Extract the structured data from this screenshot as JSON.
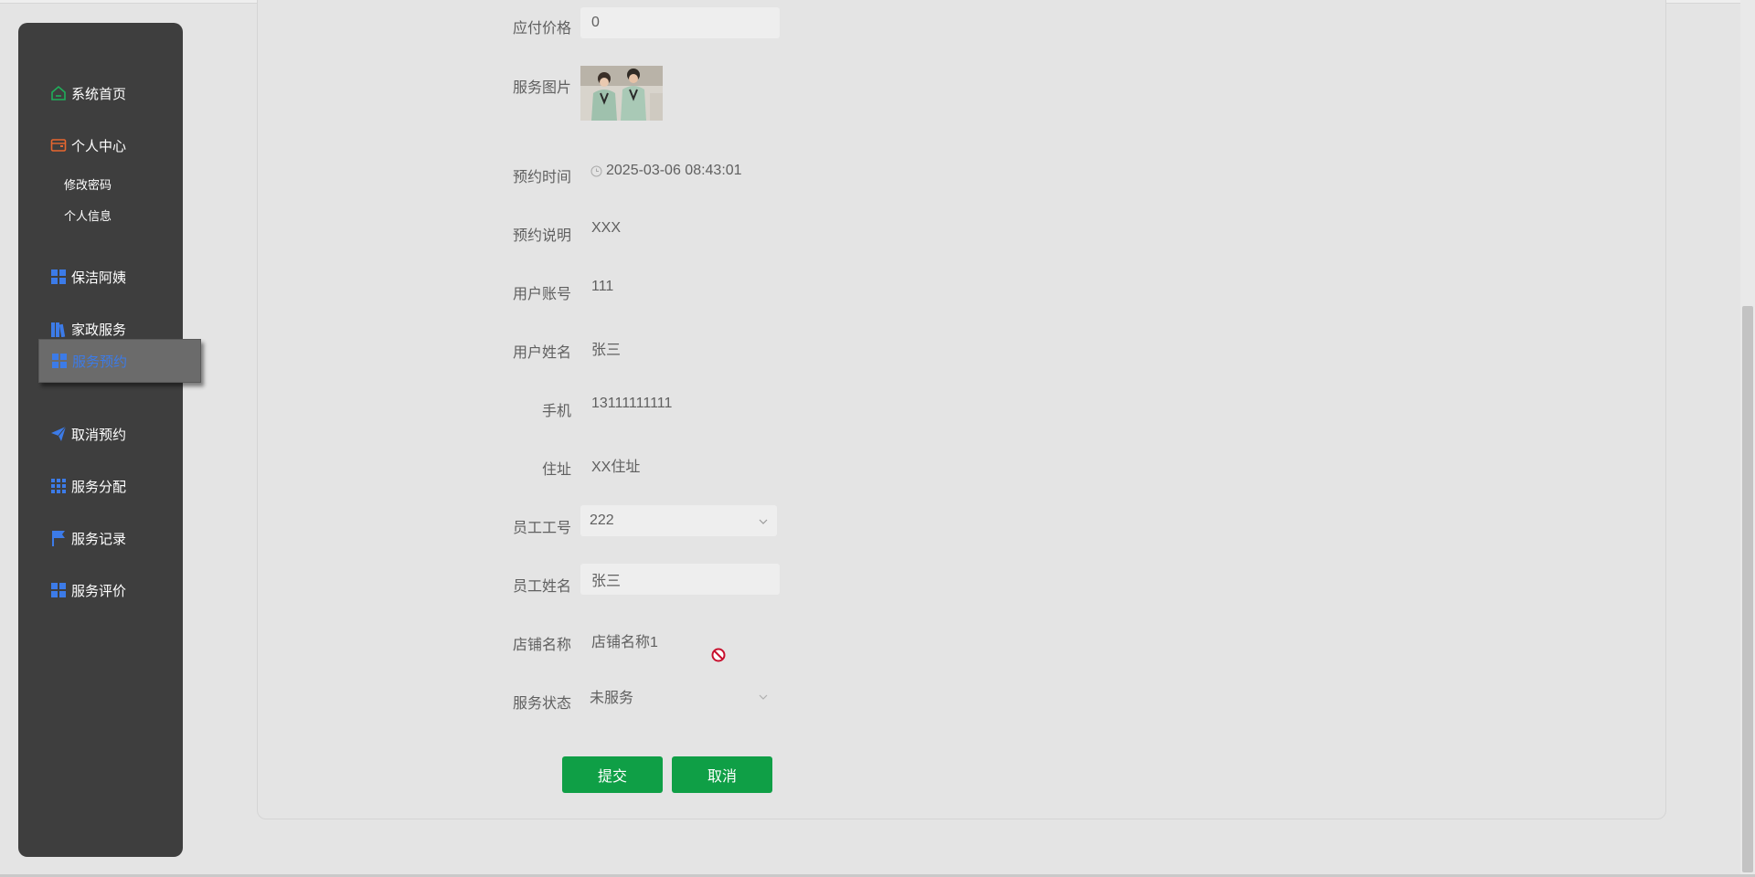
{
  "sidebar": {
    "items": [
      {
        "label": "系统首页",
        "icon": "home-icon"
      },
      {
        "label": "个人中心",
        "icon": "wallet-icon"
      },
      {
        "label": "保洁阿姨",
        "icon": "grid-icon"
      },
      {
        "label": "家政服务",
        "icon": "books-icon"
      },
      {
        "label": "服务预约",
        "icon": "grid-icon"
      },
      {
        "label": "取消预约",
        "icon": "send-icon"
      },
      {
        "label": "服务分配",
        "icon": "apps-icon"
      },
      {
        "label": "服务记录",
        "icon": "flag-icon"
      },
      {
        "label": "服务评价",
        "icon": "grid-icon"
      }
    ],
    "sub_items": [
      "修改密码",
      "个人信息"
    ],
    "active_item": "服务预约"
  },
  "form": {
    "price_label": "应付价格",
    "price_value": "0",
    "image_label": "服务图片",
    "time_label": "预约时间",
    "time_value": "2025-03-06 08:43:01",
    "desc_label": "预约说明",
    "desc_value": "XXX",
    "account_label": "用户账号",
    "account_value": "111",
    "username_label": "用户姓名",
    "username_value": "张三",
    "phone_label": "手机",
    "phone_value": "13111111111",
    "address_label": "住址",
    "address_value": "XX住址",
    "staff_id_label": "员工工号",
    "staff_id_value": "222",
    "staff_name_label": "员工姓名",
    "staff_name_value": "张三",
    "shop_label": "店铺名称",
    "shop_value": "店铺名称1",
    "status_label": "服务状态",
    "status_value": "未服务"
  },
  "buttons": {
    "submit": "提交",
    "cancel": "取消"
  },
  "colors": {
    "sidebar_bg": "#3e3e3e",
    "active_text": "#3c7be8",
    "button_green": "#0f9f46",
    "forbidden_red": "#c8102e"
  }
}
